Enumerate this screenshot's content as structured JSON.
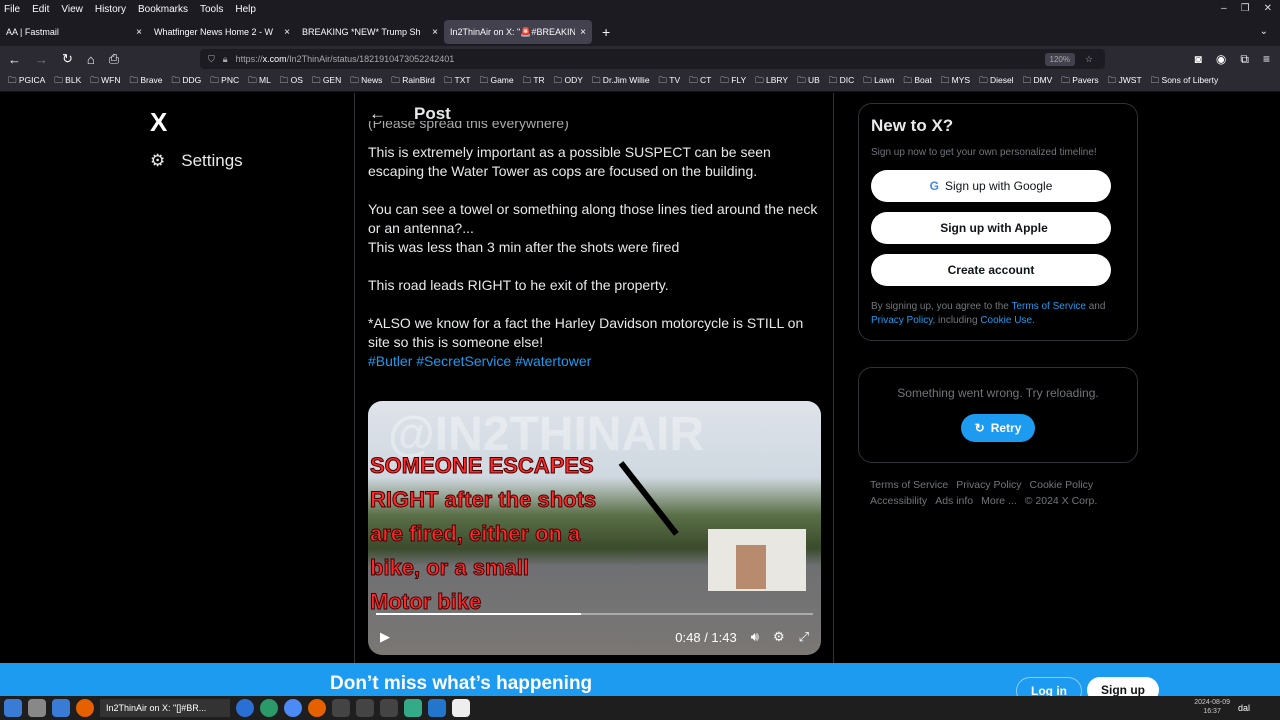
{
  "menu": [
    "File",
    "Edit",
    "View",
    "History",
    "Bookmarks",
    "Tools",
    "Help"
  ],
  "tabs": [
    {
      "label": "AA | Fastmail"
    },
    {
      "label": "Whatfinger News Home 2 - W"
    },
    {
      "label": "BREAKING *NEW* Trump Sh"
    },
    {
      "label": "In2ThinAir on X: \"🚨#BREAKIN"
    }
  ],
  "url": {
    "prefix": "https://",
    "host": "x.com",
    "path": "/In2ThinAir/status/1821910473052242401",
    "zoom": "120%"
  },
  "bookmarks": [
    "PGICA",
    "BLK",
    "WFN",
    "Brave",
    "DDG",
    "PNC",
    "ML",
    "OS",
    "GEN",
    "News",
    "RainBird",
    "TXT",
    "Game",
    "TR",
    "ODY",
    "Dr.Jim Willie",
    "TV",
    "CT",
    "FLY",
    "LBRY",
    "UB",
    "DIC",
    "Lawn",
    "Boat",
    "MYS",
    "Diesel",
    "DMV",
    "Pavers",
    "JWST",
    "Sons of Liberty"
  ],
  "sidebar": {
    "logo": "X",
    "settings": "Settings"
  },
  "post": {
    "header": "Post",
    "partial": "(Please spread this everywhere)",
    "paragraphs": [
      "This is extremely important as a possible SUSPECT can be seen escaping the Water Tower as cops are focused on the building.",
      "You can see a towel or something along those lines tied around the neck or an antenna?...",
      "This was less than 3 min after the shots were fired",
      "This road leads RIGHT to he exit of the property.",
      "*ALSO we know for a fact the Harley Davidson motorcycle is STILL on site so this is someone else!"
    ],
    "hashtags": [
      "#Butler",
      "#SecretService",
      "#watertower"
    ],
    "video": {
      "watermark": "@IN2THINAIR",
      "overlay": [
        "SOMEONE ESCAPES",
        "RIGHT after the shots",
        " are fired, either on a",
        " bike, or a small",
        " Motor bike"
      ],
      "time": "0:48 / 1:43",
      "progress": 0.47
    }
  },
  "signup": {
    "title": "New to X?",
    "sub": "Sign up now to get your own personalized timeline!",
    "google": "Sign up with Google",
    "apple": "Sign up with Apple",
    "create": "Create account",
    "legal1": "By signing up, you agree to the ",
    "tos": "Terms of Service",
    "and": " and ",
    "privacy": "Privacy Policy",
    "including": ", including ",
    "cookie": "Cookie Use",
    "end": "."
  },
  "error": {
    "msg": "Something went wrong. Try reloading.",
    "retry": "Retry"
  },
  "footer": [
    "Terms of Service",
    "Privacy Policy",
    "Cookie Policy",
    "Accessibility",
    "Ads info",
    "More ...",
    "© 2024 X Corp."
  ],
  "banner": {
    "title": "Don’t miss what’s happening",
    "login": "Log in",
    "signup": "Sign up"
  },
  "taskbar": {
    "task": "In2ThinAir on X: \"[]#BR...",
    "date": "2024-08-09",
    "time": "16:37",
    "user": "dal"
  },
  "colors": {
    "accent": "#1d9bf0"
  }
}
